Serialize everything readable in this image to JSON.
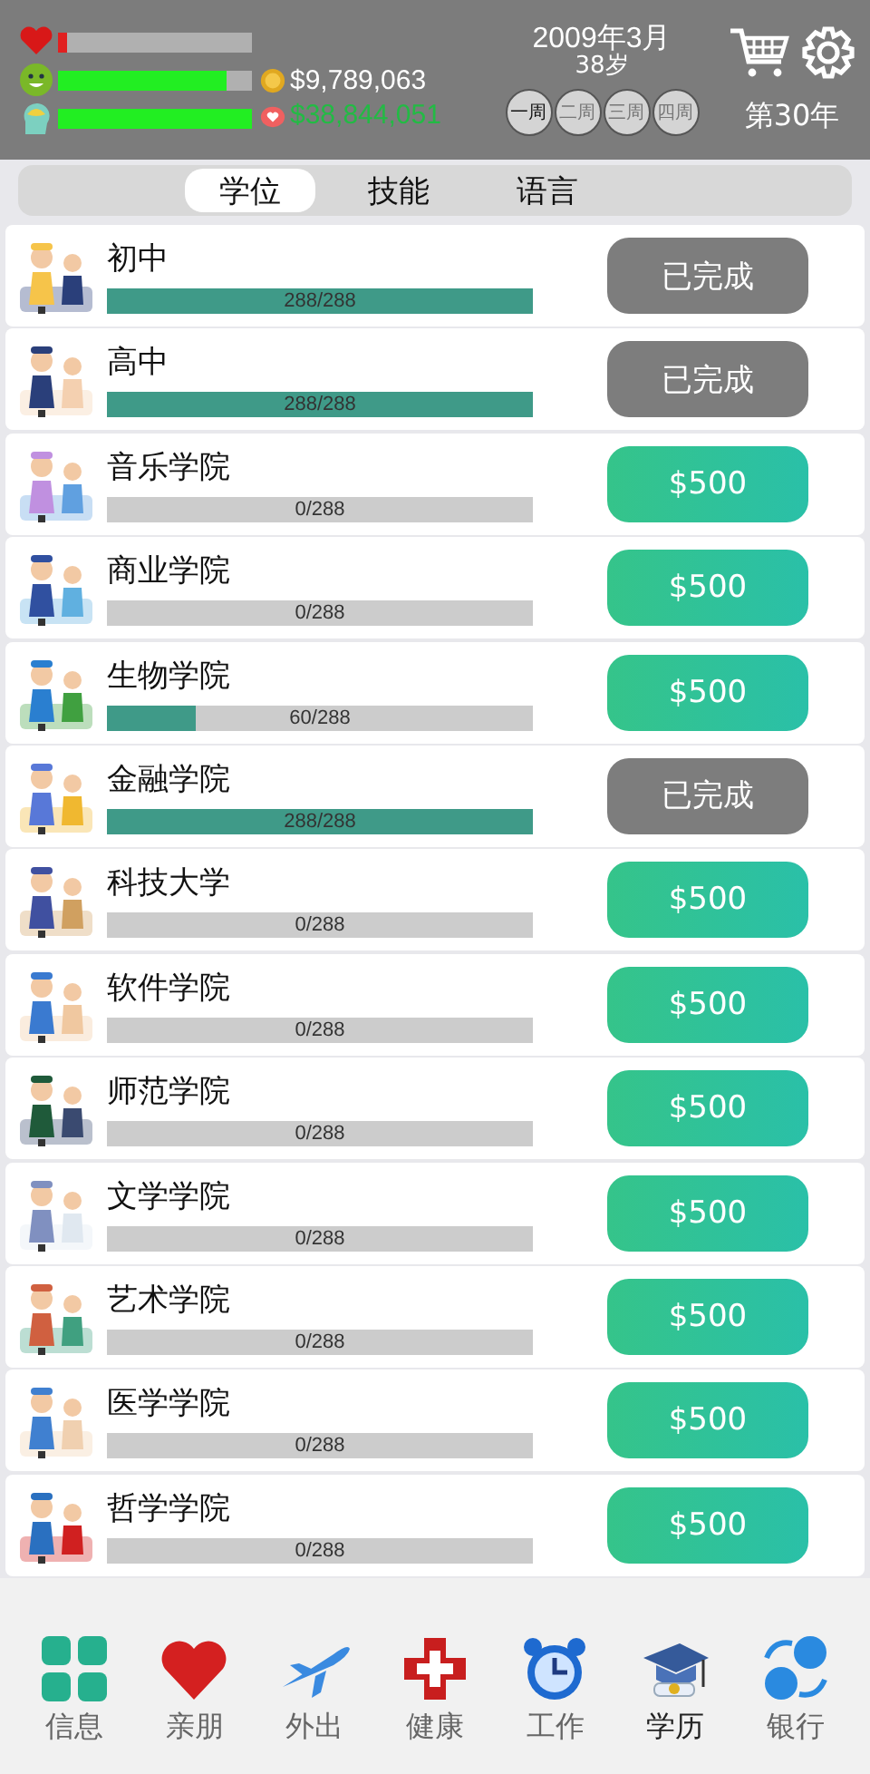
{
  "status": {
    "bars": [
      {
        "kind": "heart",
        "level": 0.05,
        "color": "#e02020"
      },
      {
        "kind": "smile",
        "level": 0.87,
        "color": "#22ee22"
      },
      {
        "kind": "head",
        "level": 1.0,
        "color": "#22ee22"
      }
    ],
    "money": [
      {
        "kind": "coin",
        "amount": "$9,789,063",
        "color": "#ffffff"
      },
      {
        "kind": "piggy",
        "amount": "$38,844,051",
        "color": "#22bb44"
      }
    ],
    "date": "2009年3月",
    "age": "38岁",
    "weeks": [
      {
        "label": "一周",
        "selected": true
      },
      {
        "label": "二周",
        "selected": false
      },
      {
        "label": "三周",
        "selected": false
      },
      {
        "label": "四周",
        "selected": false
      }
    ],
    "year": "第30年"
  },
  "tabs": [
    {
      "label": "学位",
      "selected": true
    },
    {
      "label": "技能",
      "selected": false
    },
    {
      "label": "语言",
      "selected": false
    }
  ],
  "courses": [
    {
      "name": "初中",
      "progress": "288/288",
      "level": 1.0,
      "button": "已完成",
      "kind": "done"
    },
    {
      "name": "高中",
      "progress": "288/288",
      "level": 1.0,
      "button": "已完成",
      "kind": "done"
    },
    {
      "name": "音乐学院",
      "progress": "0/288",
      "level": 0,
      "button": "$500",
      "kind": "buy"
    },
    {
      "name": "商业学院",
      "progress": "0/288",
      "level": 0,
      "button": "$500",
      "kind": "buy"
    },
    {
      "name": "生物学院",
      "progress": "60/288",
      "level": 0.21,
      "button": "$500",
      "kind": "buy"
    },
    {
      "name": "金融学院",
      "progress": "288/288",
      "level": 1.0,
      "button": "已完成",
      "kind": "done"
    },
    {
      "name": "科技大学",
      "progress": "0/288",
      "level": 0,
      "button": "$500",
      "kind": "buy"
    },
    {
      "name": "软件学院",
      "progress": "0/288",
      "level": 0,
      "button": "$500",
      "kind": "buy"
    },
    {
      "name": "师范学院",
      "progress": "0/288",
      "level": 0,
      "button": "$500",
      "kind": "buy"
    },
    {
      "name": "文学学院",
      "progress": "0/288",
      "level": 0,
      "button": "$500",
      "kind": "buy"
    },
    {
      "name": "艺术学院",
      "progress": "0/288",
      "level": 0,
      "button": "$500",
      "kind": "buy"
    },
    {
      "name": "医学学院",
      "progress": "0/288",
      "level": 0,
      "button": "$500",
      "kind": "buy"
    },
    {
      "name": "哲学学院",
      "progress": "0/288",
      "level": 0,
      "button": "$500",
      "kind": "buy"
    }
  ],
  "nav": [
    {
      "label": "信息",
      "kind": "grid",
      "selected": false
    },
    {
      "label": "亲朋",
      "kind": "heart",
      "selected": false
    },
    {
      "label": "外出",
      "kind": "plane",
      "selected": false
    },
    {
      "label": "健康",
      "kind": "cross",
      "selected": false
    },
    {
      "label": "工作",
      "kind": "clock",
      "selected": false
    },
    {
      "label": "学历",
      "kind": "cap",
      "selected": true
    },
    {
      "label": "银行",
      "kind": "bank",
      "selected": false
    }
  ]
}
